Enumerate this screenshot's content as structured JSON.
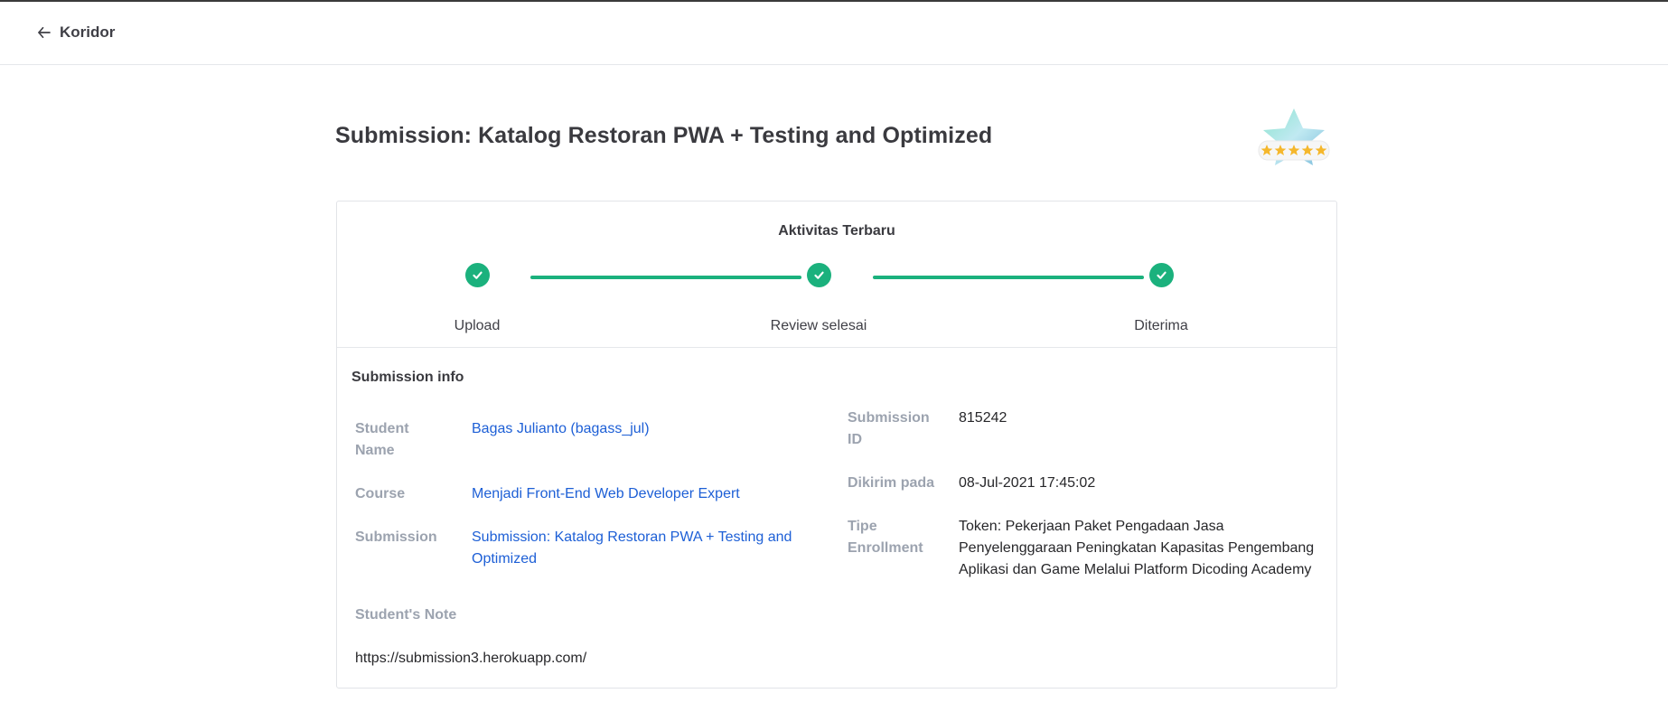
{
  "nav": {
    "back_label": "Koridor"
  },
  "page": {
    "title": "Submission: Katalog Restoran PWA + Testing and Optimized"
  },
  "badge": {
    "icon": "star-rating-badge-icon",
    "stars": 5
  },
  "activity": {
    "title": "Aktivitas Terbaru",
    "steps": [
      {
        "label": "Upload",
        "status": "done"
      },
      {
        "label": "Review selesai",
        "status": "done"
      },
      {
        "label": "Diterima",
        "status": "done"
      }
    ],
    "color": "#1bb17d"
  },
  "submission_info": {
    "title": "Submission info",
    "student_name_label": "Student Name",
    "student_name": "Bagas Julianto (bagass_jul)",
    "course_label": "Course",
    "course": "Menjadi Front-End Web Developer Expert",
    "submission_label": "Submission",
    "submission": "Submission: Katalog Restoran PWA + Testing and Optimized",
    "student_note_label": "Student's Note",
    "student_note": "https://submission3.herokuapp.com/",
    "submission_id_label": "Submission ID",
    "submission_id": "815242",
    "sent_at_label": "Dikirim pada",
    "sent_at": "08-Jul-2021 17:45:02",
    "enrollment_type_label": "Tipe Enrollment",
    "enrollment_type": "Token: Pekerjaan Paket Pengadaan Jasa Penyelenggaraan Peningkatan Kapasitas Pengembang Aplikasi dan Game Melalui Platform Dicoding Academy"
  },
  "colors": {
    "link": "#1d5fd6",
    "label": "#9ca3af",
    "accent": "#1bb17d"
  }
}
